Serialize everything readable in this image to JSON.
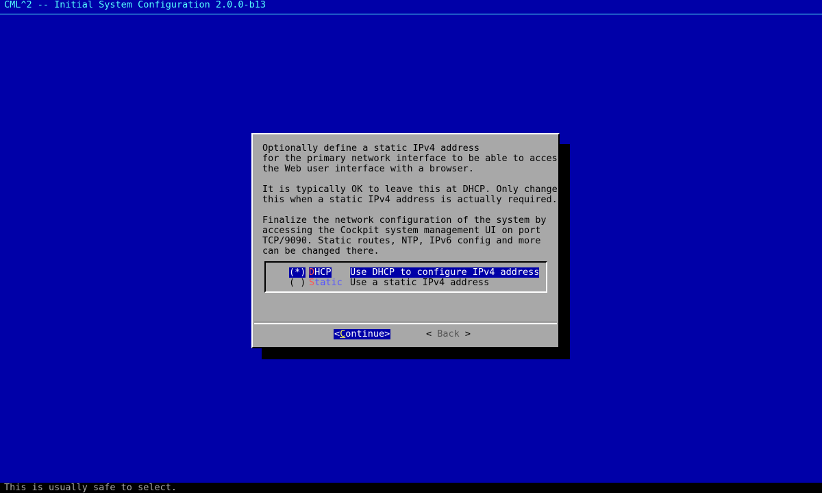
{
  "title": "CML^2 -- Initial System Configuration 2.0.0-b13",
  "dialog": {
    "message_lines": [
      "Optionally define a static IPv4 address",
      "for the primary network interface to be able to access",
      "the Web user interface with a browser.",
      "",
      "It is typically OK to leave this at DHCP. Only change",
      "this when a static IPv4 address is actually required.",
      "",
      "Finalize the network configuration of the system by",
      "accessing the Cockpit system management UI on port",
      "TCP/9090. Static routes, NTP, IPv6 config and more",
      "can be changed there."
    ],
    "options": [
      {
        "radio": "(*)",
        "tag_hot": "D",
        "tag_rest": "HCP",
        "description": "Use DHCP to configure IPv4 address",
        "selected": true
      },
      {
        "radio": "( )",
        "tag_hot": "S",
        "tag_rest": "tatic",
        "description": "Use a static IPv4 address",
        "selected": false
      }
    ],
    "buttons": {
      "continue_open": "<",
      "continue_hot": "C",
      "continue_rest": "ontinue>",
      "back_open": "<",
      "back_label": " Back ",
      "back_close": ">"
    }
  },
  "status": "This is usually safe to select.",
  "colors": {
    "background": "#0000a8",
    "dialog": "#a8a8a8",
    "title": "#55ffff",
    "hotkey": "#ff5555",
    "selection": "#0000a8"
  }
}
